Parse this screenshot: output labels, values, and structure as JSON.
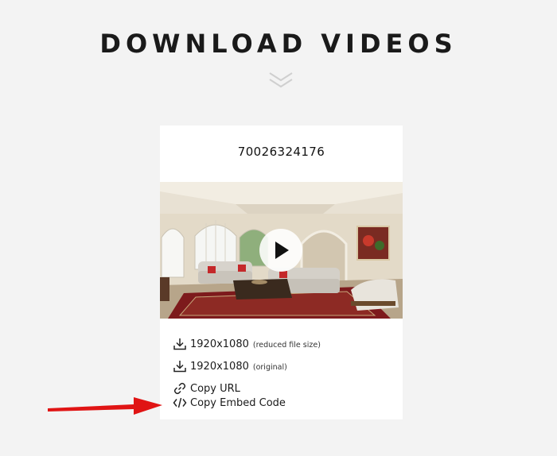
{
  "page": {
    "title": "DOWNLOAD VIDEOS",
    "chevron_icon": "double-chevron-down-icon"
  },
  "card": {
    "video_id": "70026324176",
    "thumbnail_icon": "play-icon",
    "downloads": [
      {
        "resolution": "1920x1080",
        "note": "(reduced file size)",
        "icon": "download-icon"
      },
      {
        "resolution": "1920x1080",
        "note": "(original)",
        "icon": "download-icon"
      }
    ],
    "copy_url_label": "Copy URL",
    "copy_url_icon": "link-icon",
    "copy_embed_label": "Copy Embed Code",
    "copy_embed_icon": "code-icon"
  },
  "annotation": {
    "arrow_color": "#e01414",
    "points_to": "Copy Embed Code"
  },
  "colors": {
    "background": "#f3f3f3",
    "card": "#ffffff",
    "text": "#1a1a1a"
  }
}
